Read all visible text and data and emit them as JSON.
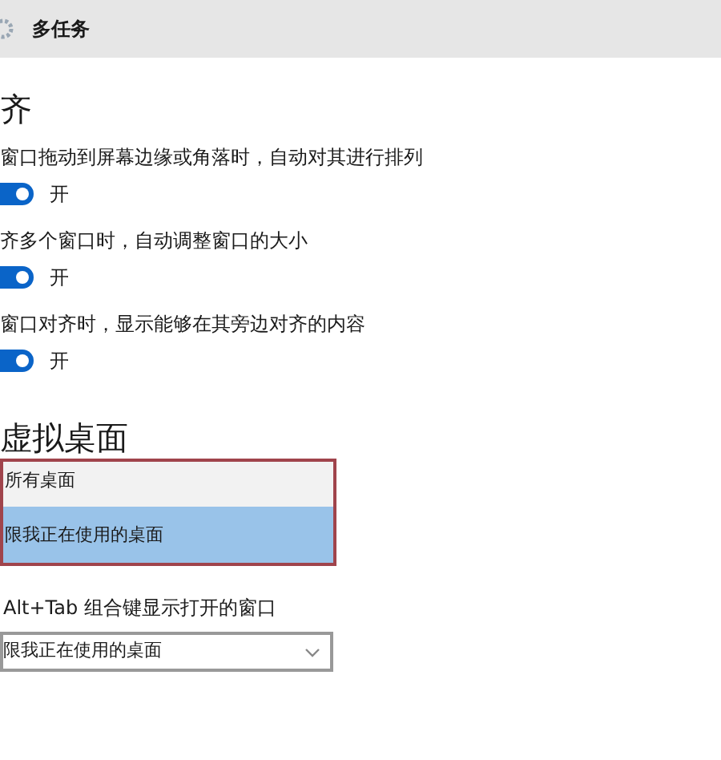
{
  "header": {
    "title": "多任务"
  },
  "snap": {
    "heading": "齐",
    "settings": [
      {
        "label": "窗口拖动到屏幕边缘或角落时，自动对其进行排列",
        "on": true,
        "state_text": "开"
      },
      {
        "label": "齐多个窗口时，自动调整窗口的大小",
        "on": true,
        "state_text": "开"
      },
      {
        "label": "窗口对齐时，显示能够在其旁边对齐的内容",
        "on": true,
        "state_text": "开"
      }
    ]
  },
  "virtual_desktops": {
    "heading": "虚拟桌面",
    "open_list": [
      {
        "label": "所有桌面",
        "selected": false
      },
      {
        "label": "限我正在使用的桌面",
        "selected": true
      }
    ],
    "alt_tab": {
      "label": "Alt+Tab 组合键显示打开的窗口",
      "value": "限我正在使用的桌面"
    }
  }
}
